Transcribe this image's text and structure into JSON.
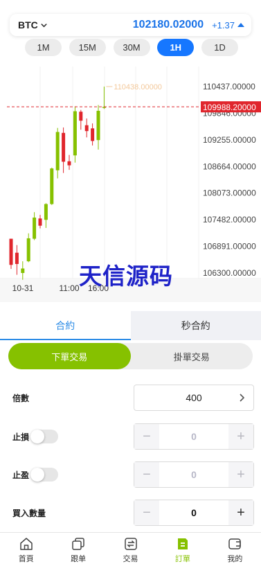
{
  "ticker": {
    "symbol": "BTC",
    "price": "102180.02000",
    "change": "+1.37"
  },
  "periods": [
    {
      "label": "1M",
      "active": false
    },
    {
      "label": "15M",
      "active": false
    },
    {
      "label": "30M",
      "active": false
    },
    {
      "label": "1H",
      "active": true
    },
    {
      "label": "1D",
      "active": false
    }
  ],
  "chart_data": {
    "type": "candlestick",
    "y_ticks": [
      "110437.00000",
      "109846.00000",
      "109255.00000",
      "108664.00000",
      "108073.00000",
      "107482.00000",
      "106891.00000",
      "106300.00000"
    ],
    "x_labels": [
      "10-31",
      "11:00",
      "16:00"
    ],
    "current_price_label": "109988.20000",
    "high_label": "110438.00000",
    "ylim": [
      106300,
      110437
    ],
    "candles": [
      {
        "o": 107060,
        "h": 107060,
        "l": 106390,
        "c": 106480
      },
      {
        "o": 106750,
        "h": 106920,
        "l": 106260,
        "c": 106500
      },
      {
        "o": 106300,
        "h": 106560,
        "l": 106150,
        "c": 106400
      },
      {
        "o": 106560,
        "h": 107180,
        "l": 106540,
        "c": 107070
      },
      {
        "o": 107060,
        "h": 107650,
        "l": 107030,
        "c": 107530
      },
      {
        "o": 107510,
        "h": 107590,
        "l": 107290,
        "c": 107350
      },
      {
        "o": 107480,
        "h": 107850,
        "l": 107300,
        "c": 107830
      },
      {
        "o": 107830,
        "h": 108640,
        "l": 107810,
        "c": 108620
      },
      {
        "o": 108580,
        "h": 109520,
        "l": 108400,
        "c": 109430
      },
      {
        "o": 109410,
        "h": 109530,
        "l": 108520,
        "c": 108770
      },
      {
        "o": 108780,
        "h": 108920,
        "l": 108590,
        "c": 108690
      },
      {
        "o": 108910,
        "h": 110000,
        "l": 108750,
        "c": 109890
      },
      {
        "o": 109880,
        "h": 109920,
        "l": 109480,
        "c": 109680
      },
      {
        "o": 109580,
        "h": 109730,
        "l": 109310,
        "c": 109450
      },
      {
        "o": 109510,
        "h": 109620,
        "l": 109130,
        "c": 109230
      },
      {
        "o": 109250,
        "h": 110030,
        "l": 109040,
        "c": 109900
      },
      {
        "o": 109988,
        "h": 110438,
        "l": 109940,
        "c": 109988
      }
    ]
  },
  "watermark": "天信源码",
  "contract_tabs": [
    {
      "label": "合約",
      "active": true
    },
    {
      "label": "秒合約",
      "active": false
    }
  ],
  "order_types": [
    {
      "label": "下單交易",
      "active": true
    },
    {
      "label": "掛單交易",
      "active": false
    }
  ],
  "form": {
    "leverage_label": "倍數",
    "leverage_value": "400",
    "stop_loss_label": "止損",
    "stop_loss_value": "0",
    "take_profit_label": "止盈",
    "take_profit_value": "0",
    "buy_qty_label": "買入數量",
    "buy_qty_value": "0",
    "minus": "−",
    "plus": "+"
  },
  "nav": [
    {
      "label": "首頁",
      "icon": "home-icon",
      "active": false
    },
    {
      "label": "跟单",
      "icon": "copy-icon",
      "active": false
    },
    {
      "label": "交易",
      "icon": "exchange-icon",
      "active": false
    },
    {
      "label": "訂單",
      "icon": "order-icon",
      "active": true
    },
    {
      "label": "我的",
      "icon": "wallet-icon",
      "active": false
    }
  ],
  "colors": {
    "up": "#86c100",
    "down": "#e0262d",
    "accent": "#1677ff",
    "tab_accent": "#2b8be6",
    "order_green": "#86c100"
  }
}
